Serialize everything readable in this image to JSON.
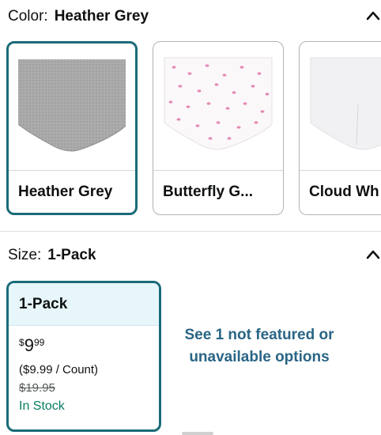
{
  "color_section": {
    "label": "Color:",
    "selected": "Heather Grey",
    "swatches": [
      {
        "label": "Heather Grey",
        "selected": true
      },
      {
        "label": "Butterfly G...",
        "selected": false
      },
      {
        "label": "Cloud Wh",
        "selected": false
      }
    ]
  },
  "size_section": {
    "label": "Size:",
    "selected": "1-Pack",
    "card": {
      "title": "1-Pack",
      "currency": "$",
      "price_whole": "9",
      "price_fraction": "99",
      "unit_price": "($9.99 / Count)",
      "list_price": "$19.95",
      "stock": "In Stock"
    },
    "see_more": "See 1 not featured or unavailable options"
  },
  "colors": {
    "accent": "#1a6b78",
    "link": "#2a6585",
    "in_stock": "#067d62",
    "card_header_bg": "#e6f6fb"
  },
  "icons": {
    "collapse": "chevron-up-icon"
  }
}
